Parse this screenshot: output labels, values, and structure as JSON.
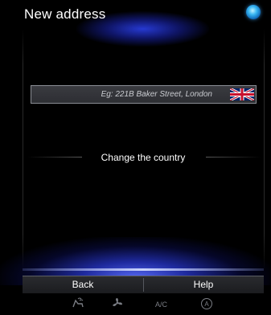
{
  "header": {
    "title": "New address"
  },
  "address": {
    "placeholder": "Eg: 221B Baker Street, London",
    "country_flag_icon": "uk-flag-icon"
  },
  "country": {
    "label": "Change the country"
  },
  "actions": {
    "back_label": "Back",
    "help_label": "Help"
  },
  "climate": {
    "seat_icon": "seat-airflow-icon",
    "fan_icon": "fan-icon",
    "ac_label": "A/C",
    "auto_label": "A"
  },
  "colors": {
    "background": "#000000",
    "accent_glow": "#2b3bd6",
    "status_dot": "#38b6f2",
    "field_bg": "#323338",
    "field_border": "#8a8d94",
    "flag_red": "#c8102e",
    "flag_blue": "#012169"
  }
}
